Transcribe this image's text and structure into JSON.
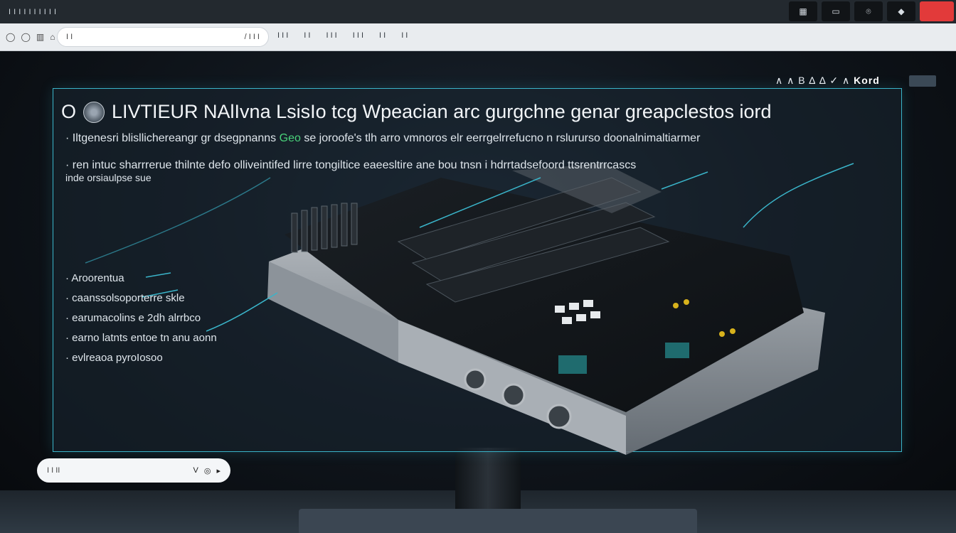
{
  "window": {
    "title": "I I  I   I I  I   I    I I   I",
    "buttons": [
      {
        "icon": "keyboard-icon",
        "label": "▦"
      },
      {
        "icon": "screen-icon",
        "label": "▭"
      },
      {
        "icon": "settings-icon",
        "label": "⌾"
      },
      {
        "icon": "diamond-icon",
        "label": "◆"
      },
      {
        "icon": "close-icon",
        "label": ""
      }
    ]
  },
  "toolbar": {
    "nav_icons": [
      "◯",
      "◯",
      "▥",
      "⌂"
    ],
    "address_left": "I I",
    "address_right": "/ I I I",
    "bookmarks": [
      "I I I",
      "I I",
      "I I I",
      "I I I",
      "I I",
      "I I"
    ]
  },
  "panel": {
    "tag_left": "∧ ∧ B ∆ ∆ ✓ ∧",
    "tag_right": "Kord",
    "headline_o": "O",
    "headline": "LIVTIEUR NAlIvna LsisIo tcg Wpeacian arc gurgchne genar greapclestos iord",
    "bullets": [
      {
        "prefix": "·",
        "text": "Iltgenesri blisllichereangr gr dsegpnanns",
        "accent": "Geo",
        "suffix": "se joroofe's tlh arro vmnoros elr eerrgelrrefucno n rslururso doonalnimaltiarmer"
      },
      {
        "prefix": "·",
        "text": "ren intuc sharrrerue thilnte defo olliveintifed lirre tongiltice eaeesltire ane bou tnsn i hdrrtadsefoord ttsrentrrcascs"
      },
      {
        "prefix": "",
        "text": "inde orsiaulpse sue"
      }
    ],
    "specs": [
      "· Aroorentua",
      "· caanssolsoporterre skle",
      "· earumacolins e 2dh alrrbco",
      "· earno latnts entoe tn anu aonn",
      "· evlreaoa pyroIosoo"
    ]
  },
  "pill": {
    "left": "I I II",
    "controls": [
      "V",
      "◎",
      "▸"
    ]
  }
}
